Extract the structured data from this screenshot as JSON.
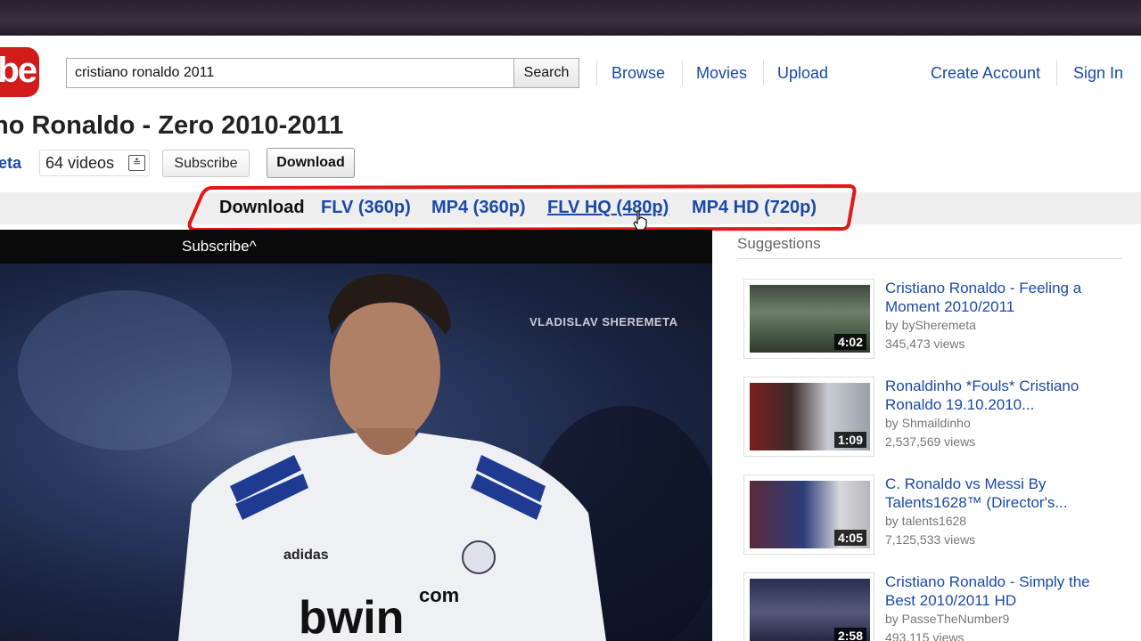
{
  "header": {
    "logo_text": "be",
    "search_value": "cristiano ronaldo 2011",
    "search_button": "Search",
    "nav": [
      "Browse",
      "Movies",
      "Upload"
    ],
    "create_account": "Create Account",
    "sign_in": "Sign In"
  },
  "video": {
    "title": "no Ronaldo - Zero 2010-2011",
    "channel": "eta",
    "videos_count": "64 videos",
    "subscribe_label": "Subscribe",
    "download_label": "Download",
    "player_subscribe": "Subscribe^",
    "watermark": "VLADISLAV SHEREMETA"
  },
  "download_bar": {
    "label": "Download",
    "formats": [
      "FLV (360p)",
      "MP4 (360p)",
      "FLV HQ (480p)",
      "MP4 HD (720p)"
    ],
    "highlight_color": "#e01818"
  },
  "suggestions": {
    "heading": "Suggestions",
    "items": [
      {
        "title": "Cristiano Ronaldo - Feeling a Moment 2010/2011",
        "by": "by bySheremeta",
        "views": "345,473 views",
        "duration": "4:02"
      },
      {
        "title": "Ronaldinho *Fouls* Cristiano Ronaldo 19.10.2010...",
        "by": "by Shmaildinho",
        "views": "2,537,569 views",
        "duration": "1:09"
      },
      {
        "title": "C. Ronaldo vs Messi By Talents1628™ (Director's...",
        "by": "by talents1628",
        "views": "7,125,533 views",
        "duration": "4:05"
      },
      {
        "title": "Cristiano Ronaldo - Simply the Best 2010/2011 HD",
        "by": "by PasseTheNumber9",
        "views": "493,115 views",
        "duration": "2:58"
      }
    ]
  },
  "colors": {
    "link": "#1a49a8",
    "brand": "#d21c1c"
  }
}
